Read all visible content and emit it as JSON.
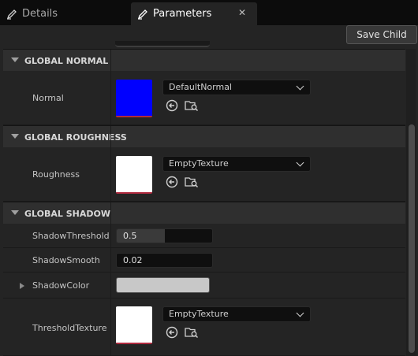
{
  "tabs": [
    {
      "label": "Details",
      "icon": "pencil-icon",
      "active": false
    },
    {
      "label": "Parameters",
      "icon": "pencil-icon",
      "active": true
    }
  ],
  "close_glyph": "✕",
  "toolbar": {
    "save_child_label": "Save Child"
  },
  "categories": {
    "normal": {
      "title": "GLOBAL NORMAL"
    },
    "roughness": {
      "title": "GLOBAL ROUGHNESS"
    },
    "shadow": {
      "title": "GLOBAL SHADOW"
    }
  },
  "params": {
    "normal": {
      "label": "Normal",
      "texture": "DefaultNormal",
      "swatch_color": "#0000ff"
    },
    "roughness": {
      "label": "Roughness",
      "texture": "EmptyTexture",
      "swatch_color": "#ffffff"
    },
    "shadow_threshold": {
      "label": "ShadowThreshold",
      "value": "0.5",
      "fill_fraction": 0.5
    },
    "shadow_smooth": {
      "label": "ShadowSmooth",
      "value": "0.02"
    },
    "shadow_color": {
      "label": "ShadowColor",
      "color": "#c8c8c8"
    },
    "threshold_texture": {
      "label": "ThresholdTexture",
      "texture": "EmptyTexture",
      "swatch_color": "#ffffff"
    }
  },
  "icons": {
    "use_selected": "use-selected-asset-icon",
    "browse": "browse-asset-icon",
    "dropdown": "chevron-down-icon",
    "collapse": "collapse-arrow-icon",
    "expand": "expand-arrow-icon"
  },
  "colors": {
    "accent_underline": "#b02a3e",
    "background": "#242424"
  }
}
